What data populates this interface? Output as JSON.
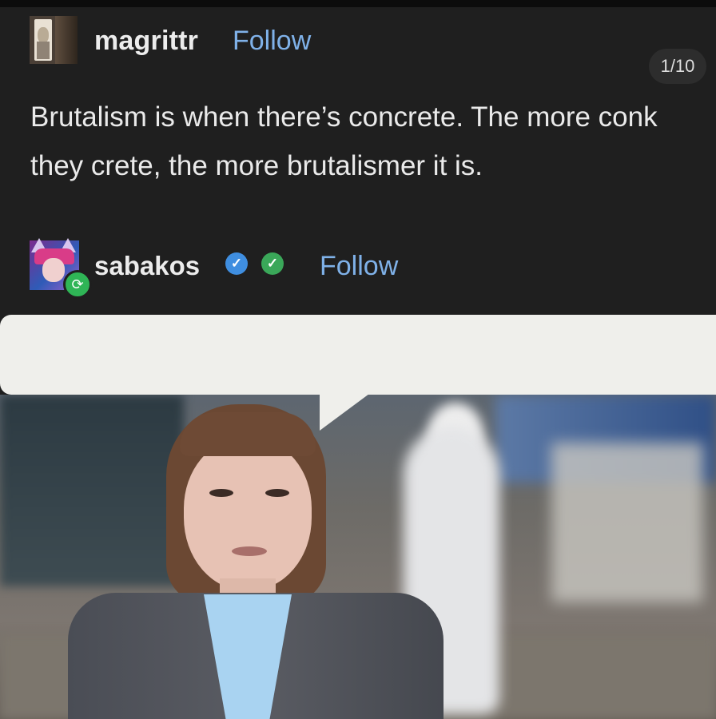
{
  "post1": {
    "username": "magrittr",
    "follow_label": "Follow",
    "counter": "1/10",
    "text": "Brutalism is when there’s concrete. The more conk they crete, the more brutalismer it is."
  },
  "post2": {
    "username": "sabakos",
    "follow_label": "Follow",
    "badges": [
      "verified-check-icon",
      "green-check-icon"
    ],
    "reblog_icon": "reblog-icon"
  },
  "colors": {
    "background": "#1f1f1f",
    "follow_link": "#7fb1e8",
    "bubble": "#efefeb"
  }
}
